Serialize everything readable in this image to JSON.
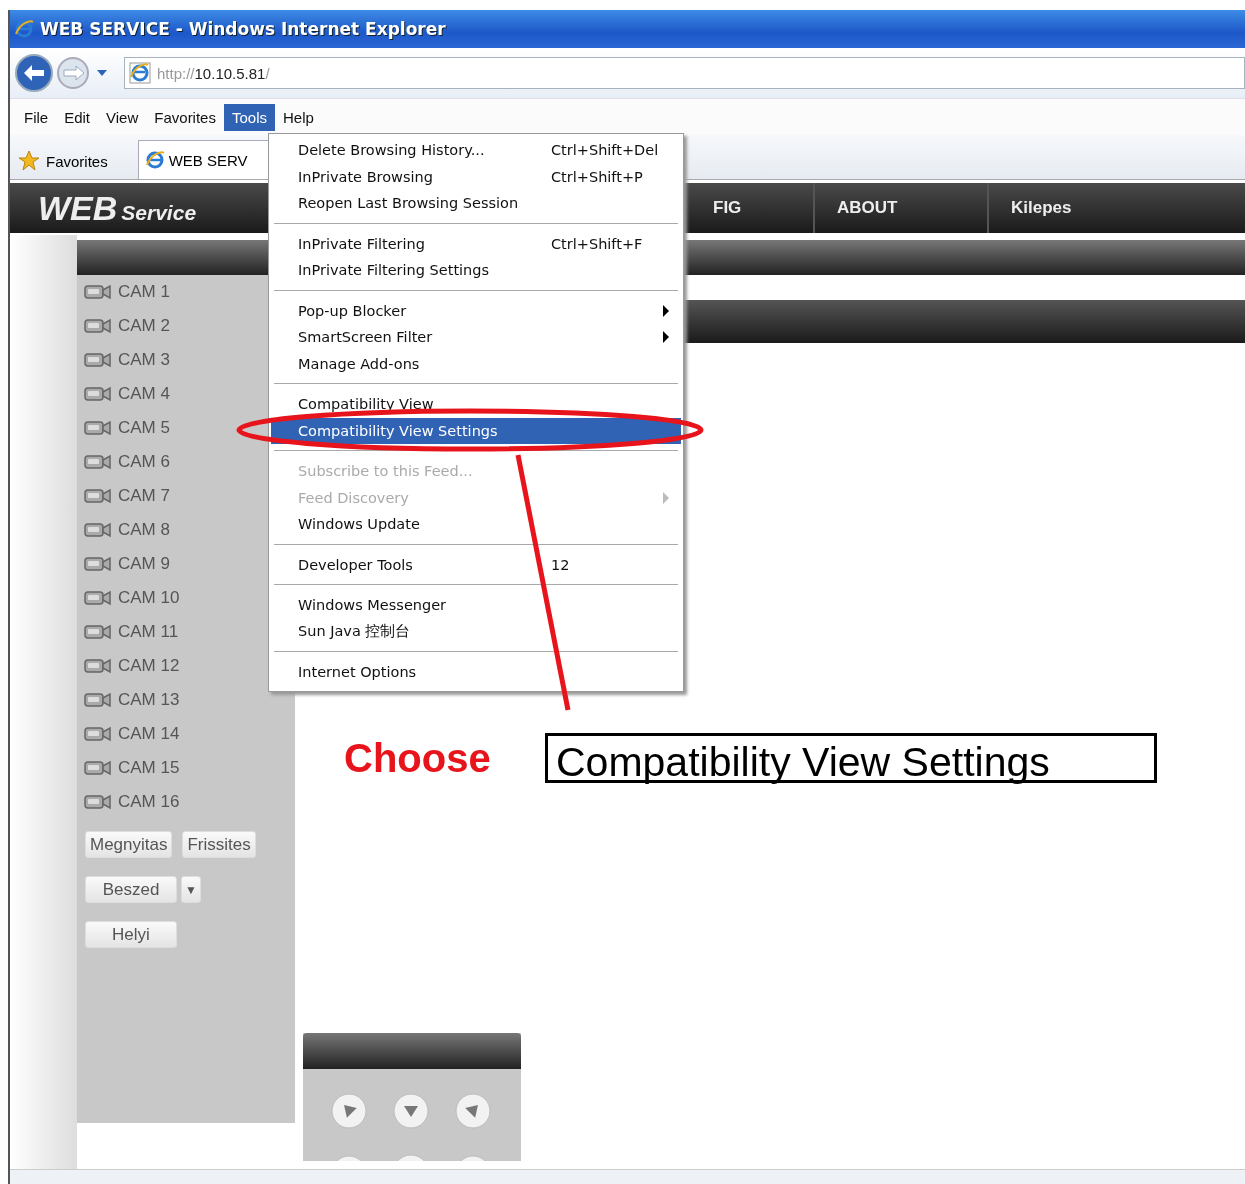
{
  "window": {
    "title": "WEB SERVICE - Windows Internet Explorer"
  },
  "address_bar": {
    "scheme": "http://",
    "host": "10.10.5.81",
    "path": "/"
  },
  "menu_bar": [
    {
      "label": "File",
      "selected": false
    },
    {
      "label": "Edit",
      "selected": false
    },
    {
      "label": "View",
      "selected": false
    },
    {
      "label": "Favorites",
      "selected": false
    },
    {
      "label": "Tools",
      "selected": true
    },
    {
      "label": "Help",
      "selected": false
    }
  ],
  "favorites_bar": {
    "favorites": "Favorites",
    "tab": "WEB SERV"
  },
  "nav": {
    "logo_main": "WEB",
    "logo_sub": "Service",
    "items": [
      "FIG",
      "ABOUT",
      "Kilepes"
    ]
  },
  "cameras": [
    "CAM 1",
    "CAM 2",
    "CAM 3",
    "CAM 4",
    "CAM 5",
    "CAM 6",
    "CAM 7",
    "CAM 8",
    "CAM 9",
    "CAM 10",
    "CAM 11",
    "CAM 12",
    "CAM 13",
    "CAM 14",
    "CAM 15",
    "CAM 16"
  ],
  "buttons": [
    {
      "kind": "pair",
      "labels": [
        "Megnyitas",
        "Frissites"
      ]
    },
    {
      "kind": "split",
      "labels": [
        "Beszed",
        "▼"
      ]
    },
    {
      "kind": "single",
      "labels": [
        "Helyi"
      ]
    }
  ],
  "tools_menu": [
    {
      "kind": "item",
      "label": "Delete Browsing History...",
      "shortcut": "Ctrl+Shift+Del",
      "submenu": false,
      "disabled": false,
      "selected": false
    },
    {
      "kind": "item",
      "label": "InPrivate Browsing",
      "shortcut": "Ctrl+Shift+P",
      "submenu": false,
      "disabled": false,
      "selected": false
    },
    {
      "kind": "item",
      "label": "Reopen Last Browsing Session",
      "submenu": false,
      "disabled": false,
      "selected": false
    },
    {
      "kind": "separator"
    },
    {
      "kind": "item",
      "label": "InPrivate Filtering",
      "shortcut": "Ctrl+Shift+F",
      "submenu": false,
      "disabled": false,
      "selected": false
    },
    {
      "kind": "item",
      "label": "InPrivate Filtering Settings",
      "submenu": false,
      "disabled": false,
      "selected": false
    },
    {
      "kind": "separator"
    },
    {
      "kind": "item",
      "label": "Pop-up Blocker",
      "submenu": true,
      "disabled": false,
      "selected": false
    },
    {
      "kind": "item",
      "label": "SmartScreen Filter",
      "submenu": true,
      "disabled": false,
      "selected": false
    },
    {
      "kind": "item",
      "label": "Manage Add-ons",
      "submenu": false,
      "disabled": false,
      "selected": false
    },
    {
      "kind": "separator"
    },
    {
      "kind": "item",
      "label": "Compatibility View",
      "submenu": false,
      "disabled": false,
      "selected": false
    },
    {
      "kind": "item",
      "label": "Compatibility View Settings",
      "submenu": false,
      "disabled": false,
      "selected": true
    },
    {
      "kind": "separator"
    },
    {
      "kind": "item",
      "label": "Subscribe to this Feed...",
      "submenu": false,
      "disabled": true,
      "selected": false
    },
    {
      "kind": "item",
      "label": "Feed Discovery",
      "submenu": true,
      "disabled": true,
      "selected": false
    },
    {
      "kind": "item",
      "label": "Windows Update",
      "submenu": false,
      "disabled": false,
      "selected": false
    },
    {
      "kind": "separator"
    },
    {
      "kind": "item",
      "label": "Developer Tools",
      "shortcut": "12",
      "submenu": false,
      "disabled": false,
      "selected": false
    },
    {
      "kind": "separator"
    },
    {
      "kind": "item",
      "label": "Windows Messenger",
      "submenu": false,
      "disabled": false,
      "selected": false
    },
    {
      "kind": "item",
      "label": "Sun Java 控制台",
      "submenu": false,
      "disabled": false,
      "selected": false
    },
    {
      "kind": "separator"
    },
    {
      "kind": "item",
      "label": "Internet Options",
      "submenu": false,
      "disabled": false,
      "selected": false
    }
  ],
  "annotation": {
    "instruction": "Choose",
    "target": "Compatibility View Settings"
  }
}
